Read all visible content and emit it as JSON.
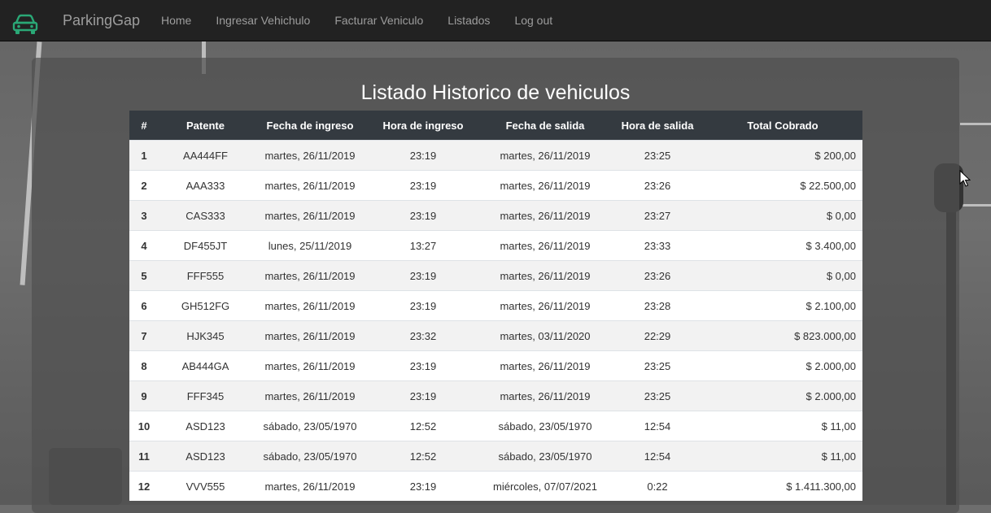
{
  "navbar": {
    "brand": "ParkingGap",
    "brand_icon": "car-icon",
    "links": [
      "Home",
      "Ingresar Vehichulo",
      "Facturar Veniculo",
      "Listados",
      "Log out"
    ]
  },
  "page": {
    "title": "Listado Historico de vehiculos"
  },
  "table": {
    "headers": [
      "#",
      "Patente",
      "Fecha de ingreso",
      "Hora de ingreso",
      "Fecha de salida",
      "Hora de salida",
      "Total Cobrado"
    ],
    "rows": [
      [
        "1",
        "AA444FF",
        "martes, 26/11/2019",
        "23:19",
        "martes, 26/11/2019",
        "23:25",
        "$ 200,00"
      ],
      [
        "2",
        "AAA333",
        "martes, 26/11/2019",
        "23:19",
        "martes, 26/11/2019",
        "23:26",
        "$ 22.500,00"
      ],
      [
        "3",
        "CAS333",
        "martes, 26/11/2019",
        "23:19",
        "martes, 26/11/2019",
        "23:27",
        "$ 0,00"
      ],
      [
        "4",
        "DF455JT",
        "lunes, 25/11/2019",
        "13:27",
        "martes, 26/11/2019",
        "23:33",
        "$ 3.400,00"
      ],
      [
        "5",
        "FFF555",
        "martes, 26/11/2019",
        "23:19",
        "martes, 26/11/2019",
        "23:26",
        "$ 0,00"
      ],
      [
        "6",
        "GH512FG",
        "martes, 26/11/2019",
        "23:19",
        "martes, 26/11/2019",
        "23:28",
        "$ 2.100,00"
      ],
      [
        "7",
        "HJK345",
        "martes, 26/11/2019",
        "23:32",
        "martes, 03/11/2020",
        "22:29",
        "$ 823.000,00"
      ],
      [
        "8",
        "AB444GA",
        "martes, 26/11/2019",
        "23:19",
        "martes, 26/11/2019",
        "23:25",
        "$ 2.000,00"
      ],
      [
        "9",
        "FFF345",
        "martes, 26/11/2019",
        "23:19",
        "martes, 26/11/2019",
        "23:25",
        "$ 2.000,00"
      ],
      [
        "10",
        "ASD123",
        "sábado, 23/05/1970",
        "12:52",
        "sábado, 23/05/1970",
        "12:54",
        "$ 11,00"
      ],
      [
        "11",
        "ASD123",
        "sábado, 23/05/1970",
        "12:52",
        "sábado, 23/05/1970",
        "12:54",
        "$ 11,00"
      ],
      [
        "12",
        "VVV555",
        "martes, 26/11/2019",
        "23:19",
        "miércoles, 07/07/2021",
        "0:22",
        "$ 1.411.300,00"
      ]
    ]
  },
  "colors": {
    "navbar_bg": "#222222",
    "brand_icon": "#2aa876",
    "table_header_bg": "#343a40"
  }
}
